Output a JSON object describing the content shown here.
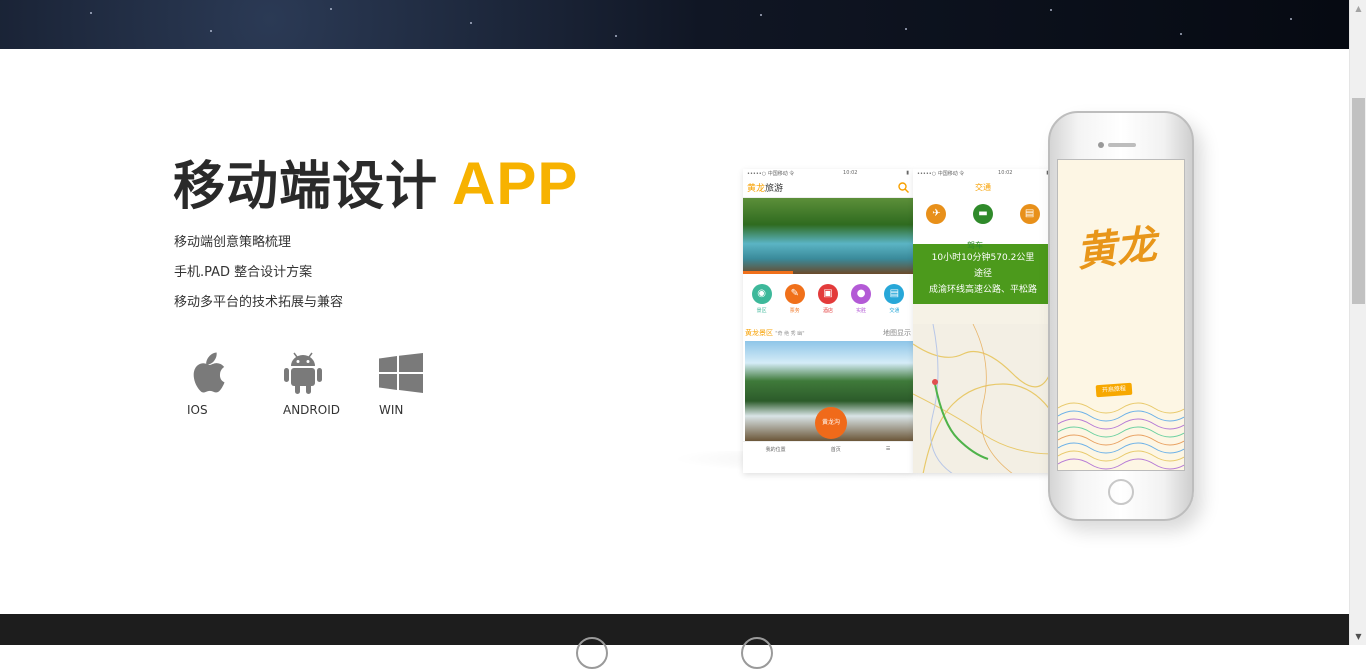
{
  "section": {
    "title": "移动端设计",
    "title_accent": "APP",
    "features": [
      "移动端创意策略梳理",
      "手机.PAD 整合设计方案",
      "移动多平台的技术拓展与兼容"
    ],
    "platforms": [
      {
        "label": "IOS",
        "icon": "apple-icon"
      },
      {
        "label": "ANDROID",
        "icon": "android-icon"
      },
      {
        "label": "WIN",
        "icon": "windows-icon"
      }
    ]
  },
  "mockup": {
    "screen1": {
      "status_left": "•••••○ 中国移动 令",
      "status_time": "10:02",
      "title_accent": "黄龙",
      "title_rest": "旅游",
      "icons": [
        {
          "label": "景区",
          "color": "#3db89a"
        },
        {
          "label": "票务",
          "color": "#f0701a"
        },
        {
          "label": "酒店",
          "color": "#e33b3b"
        },
        {
          "label": "实胜",
          "color": "#b35ad6"
        },
        {
          "label": "交通",
          "color": "#27a7d8"
        }
      ],
      "section_title": "黄龙景区",
      "section_sub": "\"奇 绝 秀 幽\"",
      "section_right": "地图显示",
      "pin_label": "黄龙沟",
      "footer": [
        "我的位置",
        "首页",
        "☰"
      ]
    },
    "screen2": {
      "status_left": "•••••○ 中国移动 令",
      "status_time": "10:02",
      "header": "交通",
      "drive_label": "驾车",
      "route_line1": "10小时10分钟570.2公里",
      "route_line2": "途径",
      "route_line3": "成渝环线高速公路、平松路",
      "icon_colors": [
        "#e8901a",
        "#2f8a2a",
        "#e8901a"
      ]
    },
    "phone": {
      "logo": "黄龙",
      "start_button": "开启旅程"
    }
  },
  "colors": {
    "accent": "#f7b200",
    "text": "#2a2a2a",
    "footer": "#1d1d1d"
  }
}
